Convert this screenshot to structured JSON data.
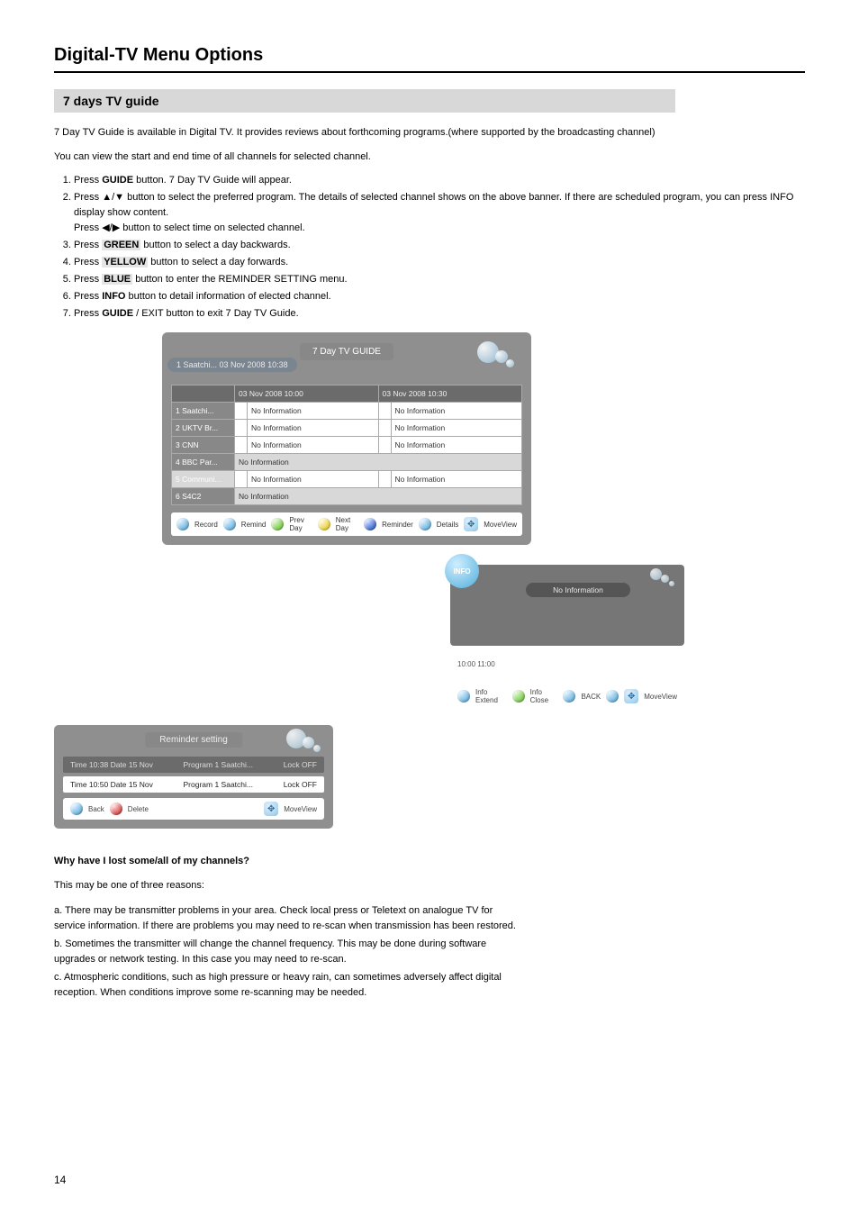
{
  "page": {
    "header": "Digital-TV Menu Options",
    "section": "7 days TV guide",
    "number": "14"
  },
  "intro": "7 Day TV Guide is available in Digital TV. It provides reviews about forthcoming programs.(where supported by the broadcasting channel)",
  "instructions": {
    "dateTimeLine": "You can view the start and end time of all channels for selected channel.",
    "steps": [
      {
        "pre": "Press ",
        "bold": "GUIDE",
        "post": " button. 7 Day TV Guide will appear."
      },
      {
        "pre": "Press ",
        "arrows": "▲/▼",
        "mid": " button to select the preferred program. The details of selected channel shows on the above banner. If there are scheduled program, you can press INFO display show content.",
        "arrows2": "◀/▶",
        "post2": " button to select time on selected channel."
      },
      {
        "pre": "Press ",
        "bold": "GREEN",
        "post": " button to select a day backwards."
      },
      {
        "pre": "Press ",
        "bold": "YELLOW",
        "post": " button to select a day forwards."
      },
      {
        "pre": "Press ",
        "bold": "BLUE",
        "post": " button to enter the REMINDER SETTING menu."
      },
      {
        "pre": "Press ",
        "bold": "INFO",
        "post": " button to detail information of elected channel."
      },
      {
        "pre": "Press ",
        "bold": "GUIDE",
        "post": " / EXIT button to exit 7 Day TV Guide."
      }
    ]
  },
  "epg": {
    "tab": "7 Day TV GUIDE",
    "date": "1 Saatchi... 03 Nov 2008 10:38",
    "timeCols": [
      "03 Nov 2008 10:00",
      "03 Nov 2008 10:30"
    ],
    "rows": [
      {
        "ch": "1 Saatchi...",
        "a": "",
        "b": "No Information",
        "c": "",
        "d": "No Information"
      },
      {
        "ch": "2 UKTV Br...",
        "a": "",
        "b": "No Information",
        "c": "",
        "d": "No Information"
      },
      {
        "ch": "3 CNN",
        "a": "",
        "b": "No Information",
        "c": "",
        "d": "No Information"
      },
      {
        "ch": "4 BBC Par...",
        "a_span": "No Information"
      },
      {
        "ch": "5 Communi...",
        "a": "",
        "b": "No Information",
        "c": "",
        "d": "No Information",
        "sel": true
      },
      {
        "ch": "6 S4C2",
        "a_span": "No Information"
      }
    ],
    "footer": {
      "record": "Record",
      "remind": "Remind",
      "prev": "Prev Day",
      "next": "Next Day",
      "reminder": "Reminder",
      "details": "Details",
      "moveView": "MoveView"
    }
  },
  "info": {
    "badge": "INFO",
    "pill": "No Information",
    "timebar": "10:00                                                11:00",
    "footer": {
      "extend": "Info Extend",
      "close": "Info Close",
      "back": "BACK",
      "moveView": "MoveView"
    }
  },
  "reminder": {
    "title": "Reminder setting",
    "rows": [
      {
        "time": "Time 10:38  Date 15 Nov",
        "prog": "Program 1 Saatchi...",
        "lock": "Lock OFF"
      },
      {
        "time": "Time 10:50  Date 15 Nov",
        "prog": "Program 1 Saatchi...",
        "lock": "Lock OFF"
      }
    ],
    "footer": {
      "back": "Back",
      "delete": "Delete",
      "moveView": "MoveView"
    }
  },
  "why": {
    "q": "Why have I lost some/all of my channels?",
    "intro": "This may be one of three reasons:",
    "items": [
      "a.  There may be transmitter problems in your area. Check local press or Teletext on analogue TV for service information. If there are problems you may need to re-scan when transmission has been restored.",
      "b.  Sometimes the transmitter will change the channel frequency. This may be done during software upgrades or network testing. In this case you may need to re-scan.",
      "c.  Atmospheric conditions, such as high pressure or heavy rain, can sometimes adversely affect digital reception. When conditions improve some re-scanning may be needed."
    ]
  }
}
